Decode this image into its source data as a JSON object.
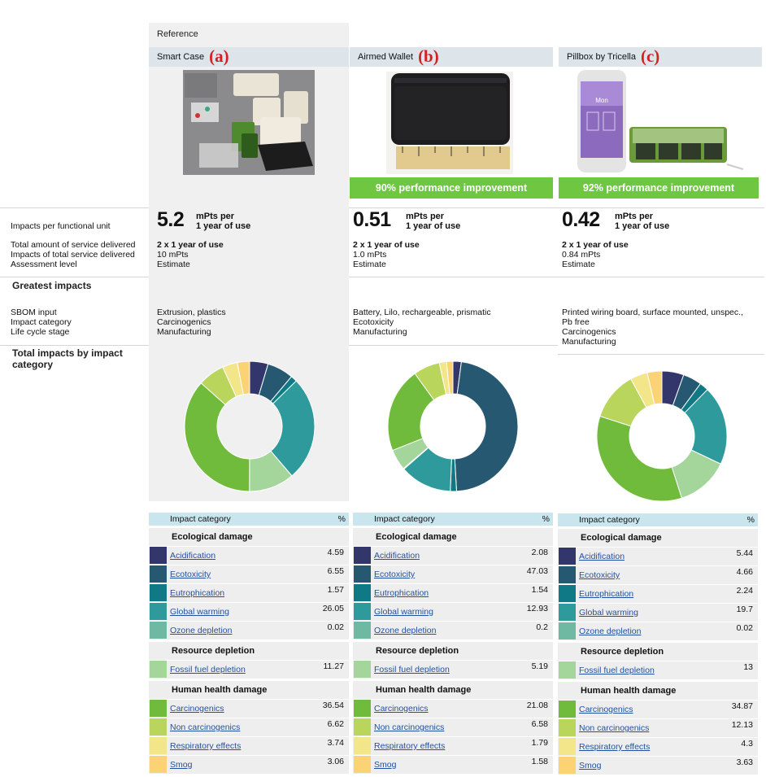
{
  "labels": {
    "reference": "Reference",
    "impacts_per_unit": "Impacts per functional unit",
    "total_service": "Total amount of service delivered",
    "impacts_total_service": "Impacts of total service delivered",
    "assessment_level": "Assessment level",
    "greatest_impacts": "Greatest impacts",
    "sbom_input": "SBOM input",
    "impact_category": "Impact category",
    "life_cycle_stage": "Life cycle stage",
    "total_impacts_title": "Total impacts by impact category",
    "table_impact_category": "Impact category",
    "table_percent": "%"
  },
  "colors": {
    "Acidification": "#33366b",
    "Ecotoxicity": "#265872",
    "Eutrophication": "#0f7a85",
    "Global warming": "#2f9a9c",
    "Ozone depletion": "#6fb8a2",
    "Fossil fuel depletion": "#a4d59a",
    "Carcinogenics": "#70bb3c",
    "Non carcinogenics": "#bad55c",
    "Respiratory effects": "#f3e589",
    "Smog": "#fbd274",
    "performance": "#6fc741",
    "header_tint": "#dde5eb",
    "table_header": "#c9e6ef"
  },
  "groups": [
    {
      "name": "Ecological damage",
      "items": [
        "Acidification",
        "Ecotoxicity",
        "Eutrophication",
        "Global warming",
        "Ozone depletion"
      ]
    },
    {
      "name": "Resource depletion",
      "items": [
        "Fossil fuel depletion"
      ]
    },
    {
      "name": "Human health damage",
      "items": [
        "Carcinogenics",
        "Non carcinogenics",
        "Respiratory effects",
        "Smog"
      ]
    }
  ],
  "products": [
    {
      "name": "Smart Case",
      "tag": "(a)",
      "performance": "",
      "big_value": "5.2",
      "unit_line1": "mPts per",
      "unit_line2": "1 year of use",
      "service": "2 x 1 year of use",
      "total_impacts": "10 mPts",
      "assessment": "Estimate",
      "sbom_lines": [
        "Extrusion, plastics"
      ],
      "greatest_category": "Carcinogenics",
      "greatest_stage": "Manufacturing"
    },
    {
      "name": "Airmed Wallet",
      "tag": "(b)",
      "performance": "90% performance improvement",
      "big_value": "0.51",
      "unit_line1": "mPts per",
      "unit_line2": "1 year of use",
      "service": "2 x 1 year of use",
      "total_impacts": "1.0 mPts",
      "assessment": "Estimate",
      "sbom_lines": [
        "Battery, Lilo, rechargeable, prismatic"
      ],
      "greatest_category": "Ecotoxicity",
      "greatest_stage": "Manufacturing"
    },
    {
      "name": "Pillbox by Tricella",
      "tag": "(c)",
      "performance": "92% performance improvement",
      "big_value": "0.42",
      "unit_line1": "mPts per",
      "unit_line2": "1 year of use",
      "service": "2 x 1 year of use",
      "total_impacts": "0.84 mPts",
      "assessment": "Estimate",
      "sbom_lines": [
        "Printed wiring board, surface mounted, unspec.,",
        "Pb free"
      ],
      "greatest_category": "Carcinogenics",
      "greatest_stage": "Manufacturing"
    }
  ],
  "chart_data": [
    {
      "type": "pie",
      "title": "",
      "categories": [
        "Acidification",
        "Ecotoxicity",
        "Eutrophication",
        "Global warming",
        "Ozone depletion",
        "Fossil fuel depletion",
        "Carcinogenics",
        "Non carcinogenics",
        "Respiratory effects",
        "Smog"
      ],
      "values": [
        4.59,
        6.55,
        1.57,
        26.05,
        0.02,
        11.27,
        36.54,
        6.62,
        3.74,
        3.06
      ],
      "donut": true
    },
    {
      "type": "pie",
      "title": "",
      "categories": [
        "Acidification",
        "Ecotoxicity",
        "Eutrophication",
        "Global warming",
        "Ozone depletion",
        "Fossil fuel depletion",
        "Carcinogenics",
        "Non carcinogenics",
        "Respiratory effects",
        "Smog"
      ],
      "values": [
        2.08,
        47.03,
        1.54,
        12.93,
        0.2,
        5.19,
        21.08,
        6.58,
        1.79,
        1.58
      ],
      "donut": true
    },
    {
      "type": "pie",
      "title": "",
      "categories": [
        "Acidification",
        "Ecotoxicity",
        "Eutrophication",
        "Global warming",
        "Ozone depletion",
        "Fossil fuel depletion",
        "Carcinogenics",
        "Non carcinogenics",
        "Respiratory effects",
        "Smog"
      ],
      "values": [
        5.44,
        4.66,
        2.24,
        19.7,
        0.02,
        13,
        34.87,
        12.13,
        4.3,
        3.63
      ],
      "donut": true
    }
  ]
}
